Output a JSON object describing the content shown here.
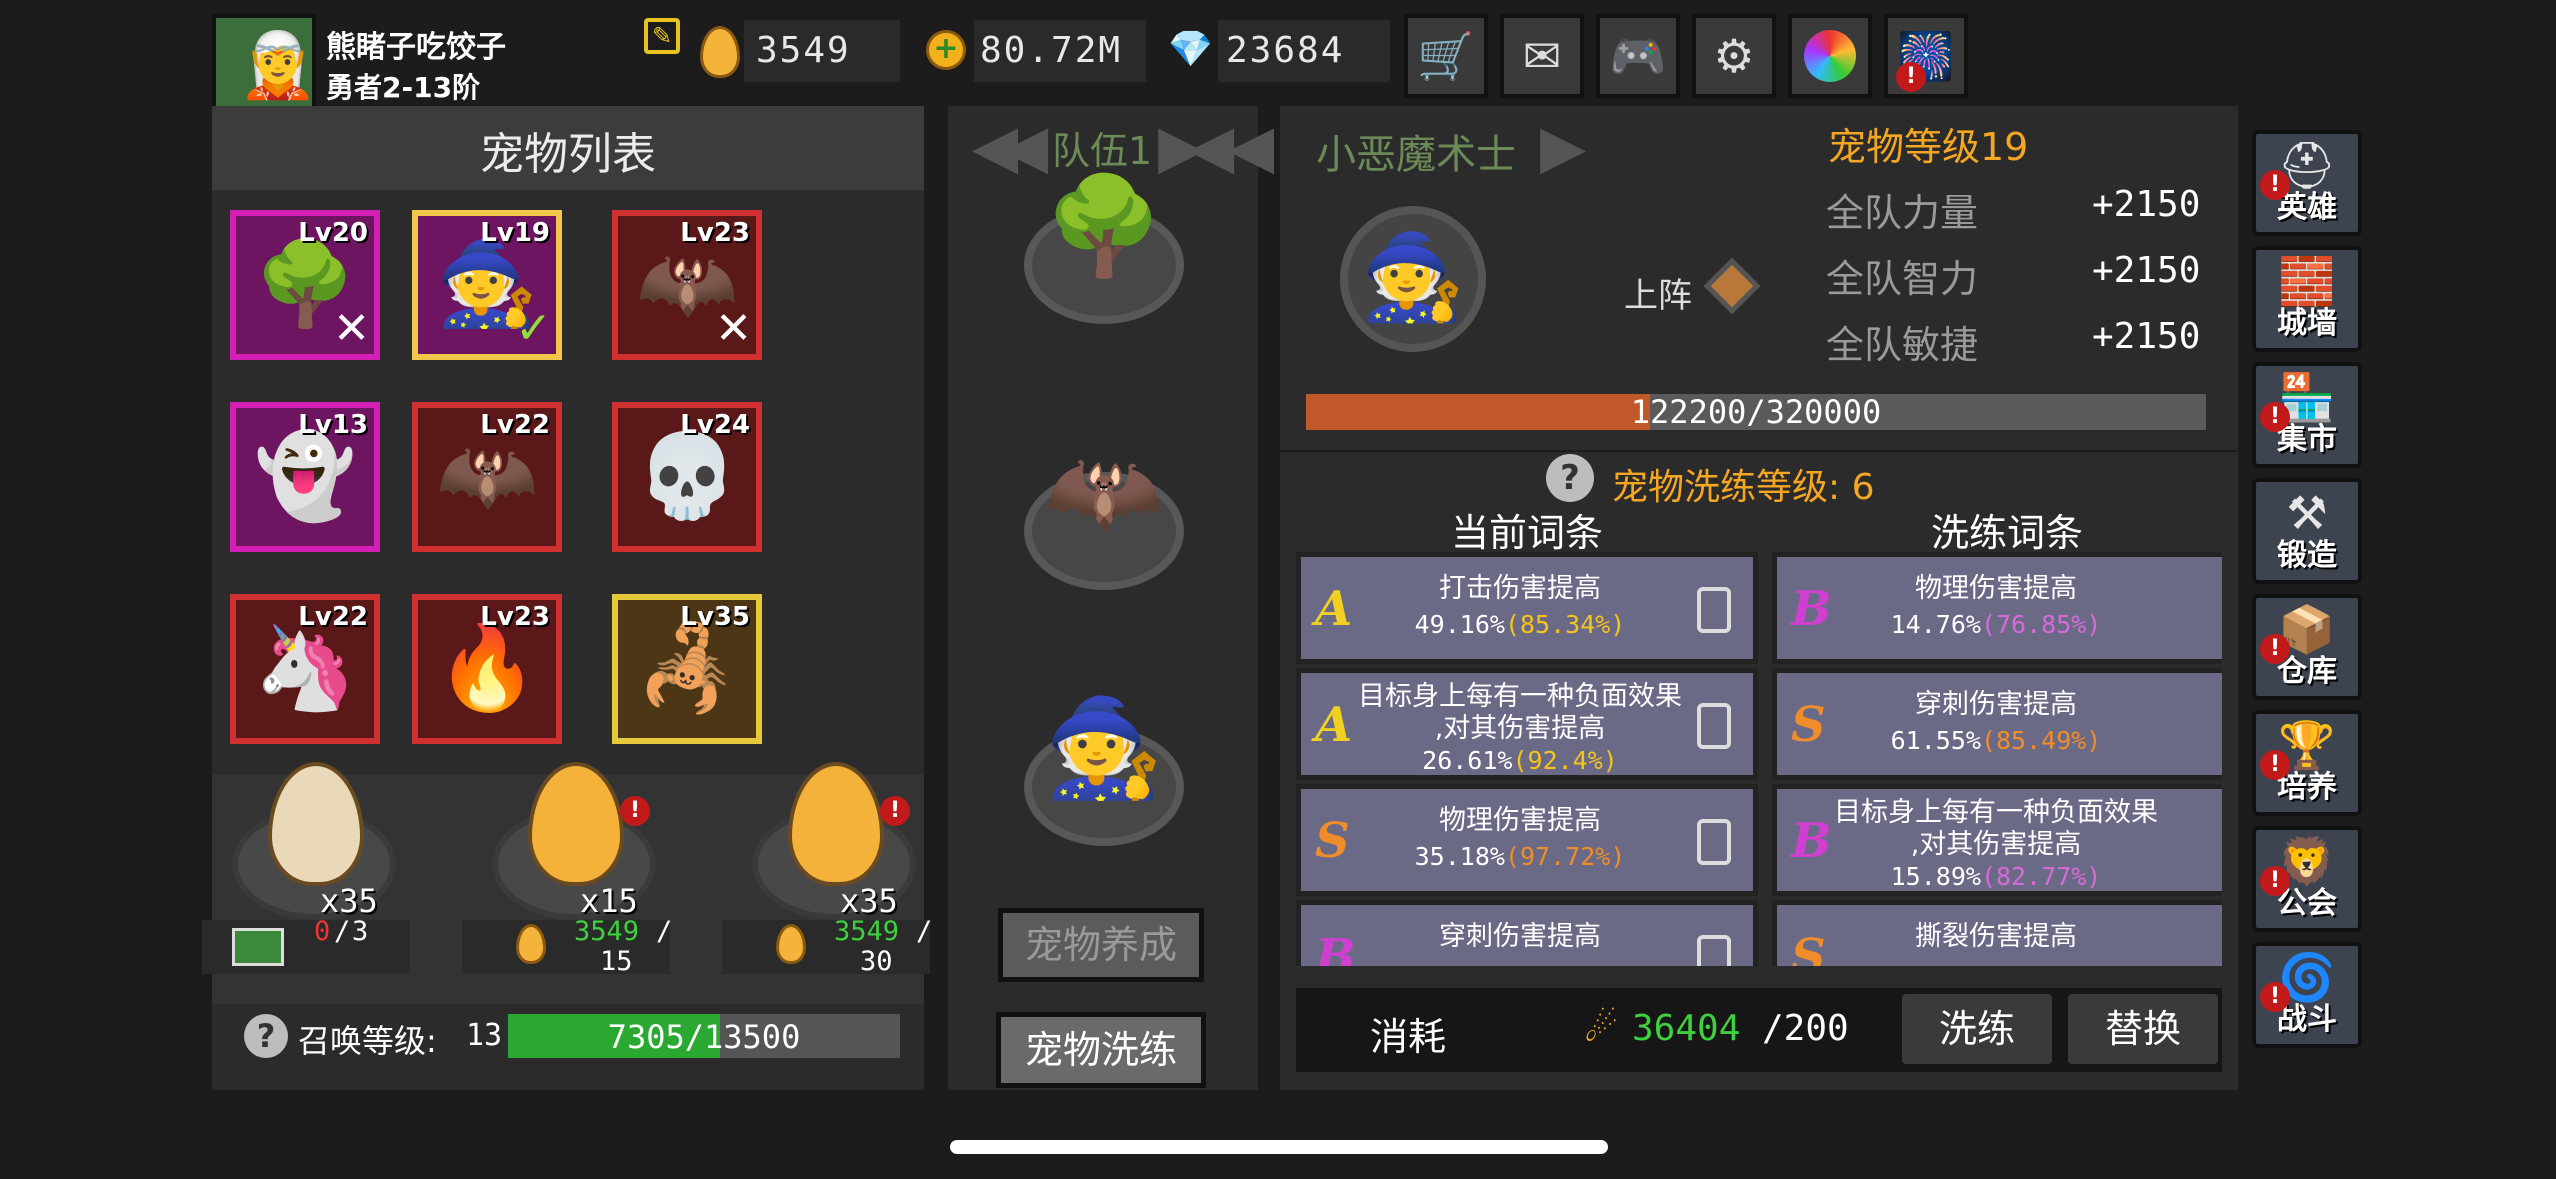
{
  "player": {
    "name": "熊睹子吃饺子",
    "rank": "勇者2-13阶"
  },
  "currencies": [
    {
      "icon": "gold-egg-icon",
      "value": "3549"
    },
    {
      "icon": "coin-plus-icon",
      "value": "80.72M"
    },
    {
      "icon": "diamond-plus-icon",
      "value": "23684"
    }
  ],
  "top_buttons": [
    "shop-cart-icon",
    "mail-icon",
    "gamepad-icon",
    "gear-icon",
    "color-wheel-icon",
    "fireworks-icon"
  ],
  "pet_list": {
    "title": "宠物列表",
    "pets": [
      {
        "level": "Lv20",
        "glyph": "🌳",
        "border": "#d41fb4",
        "bg": "#6e1561",
        "mark": "✕"
      },
      {
        "level": "Lv19",
        "glyph": "🧙",
        "border": "#f2c84a",
        "bg": "#6e1561",
        "mark": "✓"
      },
      {
        "level": "Lv23",
        "glyph": "🦇",
        "border": "#d13030",
        "bg": "#5a1818",
        "mark": "✕"
      },
      {
        "level": "Lv13",
        "glyph": "👻",
        "border": "#d41fb4",
        "bg": "#6e1561",
        "mark": ""
      },
      {
        "level": "Lv22",
        "glyph": "🦇",
        "border": "#d13030",
        "bg": "#5a1818",
        "mark": ""
      },
      {
        "level": "Lv24",
        "glyph": "💀",
        "border": "#d13030",
        "bg": "#5a1818",
        "mark": ""
      },
      {
        "level": "Lv22",
        "glyph": "🦄",
        "border": "#d13030",
        "bg": "#5a1818",
        "mark": ""
      },
      {
        "level": "Lv23",
        "glyph": "🔥",
        "border": "#d13030",
        "bg": "#5a1818",
        "mark": ""
      },
      {
        "level": "Lv35",
        "glyph": "🦂",
        "border": "#e6c93a",
        "bg": "#4d3616",
        "mark": ""
      }
    ]
  },
  "eggs": [
    {
      "count": "x35",
      "color": "#e9d9b9",
      "alert": false,
      "cost_current": "0",
      "cost_sep": "/",
      "cost_total": "3",
      "cost_icon": "ad-video-icon"
    },
    {
      "count": "x15",
      "color": "#f5b23a",
      "alert": true,
      "cost_current": "3549",
      "cost_sep": "/",
      "cost_total": "15",
      "cost_icon": "gold-egg-icon"
    },
    {
      "count": "x35",
      "color": "#f5b23a",
      "alert": true,
      "cost_current": "3549",
      "cost_sep": "/",
      "cost_total": "30",
      "cost_icon": "gold-egg-icon"
    }
  ],
  "summon": {
    "label": "召唤等级:",
    "level": "13",
    "progress_text": "7305/13500",
    "progress": 0.541
  },
  "team": {
    "label": "队伍1",
    "pet_name": "小恶魔术士",
    "slots": [
      "🌳",
      "🦇",
      "🧙"
    ]
  },
  "center_buttons": {
    "nurture": "宠物养成",
    "refine": "宠物洗练"
  },
  "pet_detail": {
    "level_text": "宠物等级19",
    "deploy_label": "上阵",
    "stats": [
      {
        "name": "全队力量",
        "value": "+2150"
      },
      {
        "name": "全队智力",
        "value": "+2150"
      },
      {
        "name": "全队敏捷",
        "value": "+2150"
      }
    ],
    "exp_text": "122200/320000",
    "exp_progress": 0.382
  },
  "refine": {
    "level_label": "宠物洗练等级: 6",
    "current_header": "当前词条",
    "refine_header": "洗练词条",
    "current": [
      {
        "grade": "A",
        "grade_color": "#f0d020",
        "line1": "打击伤害提高",
        "line2": "",
        "value": "49.16%",
        "max": "(85.34%)",
        "max_color": "#f5c518"
      },
      {
        "grade": "A",
        "grade_color": "#f0d020",
        "line1": "目标身上每有一种负面效果",
        "line2": ",对其伤害提高",
        "value": "26.61%",
        "max": "(92.4%)",
        "max_color": "#f5c518"
      },
      {
        "grade": "S",
        "grade_color": "#f08c2a",
        "line1": "物理伤害提高",
        "line2": "",
        "value": "35.18%",
        "max": "(97.72%)",
        "max_color": "#f08c2a"
      },
      {
        "grade": "B",
        "grade_color": "#d040d0",
        "line1": "穿刺伤害提高",
        "line2": "",
        "value": "",
        "max": "",
        "max_color": "#d040d0"
      }
    ],
    "candidates": [
      {
        "grade": "B",
        "grade_color": "#d040d0",
        "line1": "物理伤害提高",
        "line2": "",
        "value": "14.76%",
        "max": "(76.85%)",
        "max_color": "#d86ad8"
      },
      {
        "grade": "S",
        "grade_color": "#f08c2a",
        "line1": "穿刺伤害提高",
        "line2": "",
        "value": "61.55%",
        "max": "(85.49%)",
        "max_color": "#f08c2a"
      },
      {
        "grade": "B",
        "grade_color": "#d040d0",
        "line1": "目标身上每有一种负面效果",
        "line2": ",对其伤害提高",
        "value": "15.89%",
        "max": "(82.77%)",
        "max_color": "#d86ad8"
      },
      {
        "grade": "S",
        "grade_color": "#f08c2a",
        "line1": "撕裂伤害提高",
        "line2": "",
        "value": "",
        "max": "",
        "max_color": "#f08c2a"
      }
    ],
    "cost_label": "消耗",
    "cost_have": "36404",
    "cost_need": "/200",
    "refine_button": "洗练",
    "replace_button": "替换"
  },
  "side_menu": [
    {
      "label": "英雄",
      "glyph": "⛑",
      "alert": true
    },
    {
      "label": "城墙",
      "glyph": "🧱",
      "alert": false
    },
    {
      "label": "集市",
      "glyph": "🏪",
      "alert": true
    },
    {
      "label": "锻造",
      "glyph": "⚒",
      "alert": false
    },
    {
      "label": "仓库",
      "glyph": "📦",
      "alert": true
    },
    {
      "label": "培养",
      "glyph": "🏆",
      "alert": true
    },
    {
      "label": "公会",
      "glyph": "🦁",
      "alert": true
    },
    {
      "label": "战斗",
      "glyph": "🌀",
      "alert": true
    }
  ],
  "colors": {
    "accent_orange": "#f5a623",
    "exp_bar": "#c0582a",
    "summon_bar": "#2aa832"
  }
}
